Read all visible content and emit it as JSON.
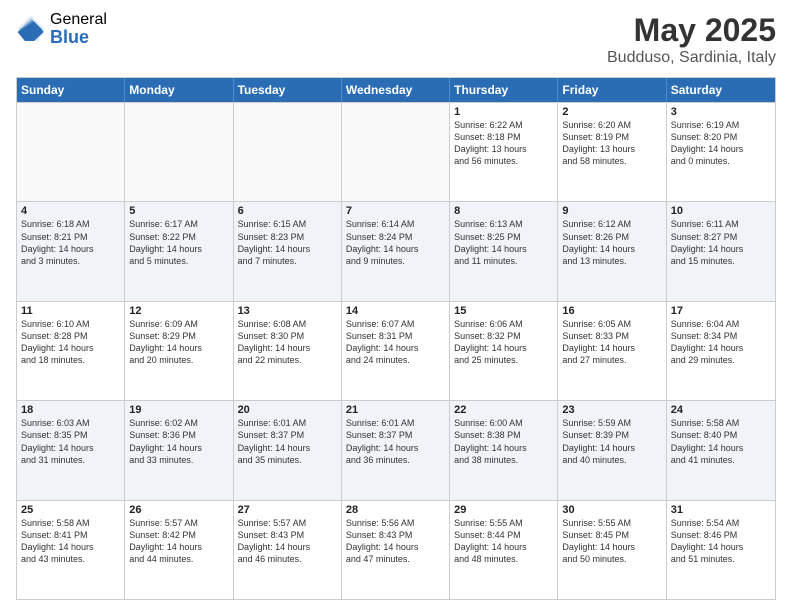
{
  "logo": {
    "general": "General",
    "blue": "Blue"
  },
  "title": {
    "month": "May 2025",
    "location": "Budduso, Sardinia, Italy"
  },
  "header_days": [
    "Sunday",
    "Monday",
    "Tuesday",
    "Wednesday",
    "Thursday",
    "Friday",
    "Saturday"
  ],
  "rows": [
    [
      {
        "day": "",
        "info": "",
        "empty": true
      },
      {
        "day": "",
        "info": "",
        "empty": true
      },
      {
        "day": "",
        "info": "",
        "empty": true
      },
      {
        "day": "",
        "info": "",
        "empty": true
      },
      {
        "day": "1",
        "info": "Sunrise: 6:22 AM\nSunset: 8:18 PM\nDaylight: 13 hours\nand 56 minutes.",
        "empty": false
      },
      {
        "day": "2",
        "info": "Sunrise: 6:20 AM\nSunset: 8:19 PM\nDaylight: 13 hours\nand 58 minutes.",
        "empty": false
      },
      {
        "day": "3",
        "info": "Sunrise: 6:19 AM\nSunset: 8:20 PM\nDaylight: 14 hours\nand 0 minutes.",
        "empty": false
      }
    ],
    [
      {
        "day": "4",
        "info": "Sunrise: 6:18 AM\nSunset: 8:21 PM\nDaylight: 14 hours\nand 3 minutes.",
        "empty": false
      },
      {
        "day": "5",
        "info": "Sunrise: 6:17 AM\nSunset: 8:22 PM\nDaylight: 14 hours\nand 5 minutes.",
        "empty": false
      },
      {
        "day": "6",
        "info": "Sunrise: 6:15 AM\nSunset: 8:23 PM\nDaylight: 14 hours\nand 7 minutes.",
        "empty": false
      },
      {
        "day": "7",
        "info": "Sunrise: 6:14 AM\nSunset: 8:24 PM\nDaylight: 14 hours\nand 9 minutes.",
        "empty": false
      },
      {
        "day": "8",
        "info": "Sunrise: 6:13 AM\nSunset: 8:25 PM\nDaylight: 14 hours\nand 11 minutes.",
        "empty": false
      },
      {
        "day": "9",
        "info": "Sunrise: 6:12 AM\nSunset: 8:26 PM\nDaylight: 14 hours\nand 13 minutes.",
        "empty": false
      },
      {
        "day": "10",
        "info": "Sunrise: 6:11 AM\nSunset: 8:27 PM\nDaylight: 14 hours\nand 15 minutes.",
        "empty": false
      }
    ],
    [
      {
        "day": "11",
        "info": "Sunrise: 6:10 AM\nSunset: 8:28 PM\nDaylight: 14 hours\nand 18 minutes.",
        "empty": false
      },
      {
        "day": "12",
        "info": "Sunrise: 6:09 AM\nSunset: 8:29 PM\nDaylight: 14 hours\nand 20 minutes.",
        "empty": false
      },
      {
        "day": "13",
        "info": "Sunrise: 6:08 AM\nSunset: 8:30 PM\nDaylight: 14 hours\nand 22 minutes.",
        "empty": false
      },
      {
        "day": "14",
        "info": "Sunrise: 6:07 AM\nSunset: 8:31 PM\nDaylight: 14 hours\nand 24 minutes.",
        "empty": false
      },
      {
        "day": "15",
        "info": "Sunrise: 6:06 AM\nSunset: 8:32 PM\nDaylight: 14 hours\nand 25 minutes.",
        "empty": false
      },
      {
        "day": "16",
        "info": "Sunrise: 6:05 AM\nSunset: 8:33 PM\nDaylight: 14 hours\nand 27 minutes.",
        "empty": false
      },
      {
        "day": "17",
        "info": "Sunrise: 6:04 AM\nSunset: 8:34 PM\nDaylight: 14 hours\nand 29 minutes.",
        "empty": false
      }
    ],
    [
      {
        "day": "18",
        "info": "Sunrise: 6:03 AM\nSunset: 8:35 PM\nDaylight: 14 hours\nand 31 minutes.",
        "empty": false
      },
      {
        "day": "19",
        "info": "Sunrise: 6:02 AM\nSunset: 8:36 PM\nDaylight: 14 hours\nand 33 minutes.",
        "empty": false
      },
      {
        "day": "20",
        "info": "Sunrise: 6:01 AM\nSunset: 8:37 PM\nDaylight: 14 hours\nand 35 minutes.",
        "empty": false
      },
      {
        "day": "21",
        "info": "Sunrise: 6:01 AM\nSunset: 8:37 PM\nDaylight: 14 hours\nand 36 minutes.",
        "empty": false
      },
      {
        "day": "22",
        "info": "Sunrise: 6:00 AM\nSunset: 8:38 PM\nDaylight: 14 hours\nand 38 minutes.",
        "empty": false
      },
      {
        "day": "23",
        "info": "Sunrise: 5:59 AM\nSunset: 8:39 PM\nDaylight: 14 hours\nand 40 minutes.",
        "empty": false
      },
      {
        "day": "24",
        "info": "Sunrise: 5:58 AM\nSunset: 8:40 PM\nDaylight: 14 hours\nand 41 minutes.",
        "empty": false
      }
    ],
    [
      {
        "day": "25",
        "info": "Sunrise: 5:58 AM\nSunset: 8:41 PM\nDaylight: 14 hours\nand 43 minutes.",
        "empty": false
      },
      {
        "day": "26",
        "info": "Sunrise: 5:57 AM\nSunset: 8:42 PM\nDaylight: 14 hours\nand 44 minutes.",
        "empty": false
      },
      {
        "day": "27",
        "info": "Sunrise: 5:57 AM\nSunset: 8:43 PM\nDaylight: 14 hours\nand 46 minutes.",
        "empty": false
      },
      {
        "day": "28",
        "info": "Sunrise: 5:56 AM\nSunset: 8:43 PM\nDaylight: 14 hours\nand 47 minutes.",
        "empty": false
      },
      {
        "day": "29",
        "info": "Sunrise: 5:55 AM\nSunset: 8:44 PM\nDaylight: 14 hours\nand 48 minutes.",
        "empty": false
      },
      {
        "day": "30",
        "info": "Sunrise: 5:55 AM\nSunset: 8:45 PM\nDaylight: 14 hours\nand 50 minutes.",
        "empty": false
      },
      {
        "day": "31",
        "info": "Sunrise: 5:54 AM\nSunset: 8:46 PM\nDaylight: 14 hours\nand 51 minutes.",
        "empty": false
      }
    ]
  ]
}
